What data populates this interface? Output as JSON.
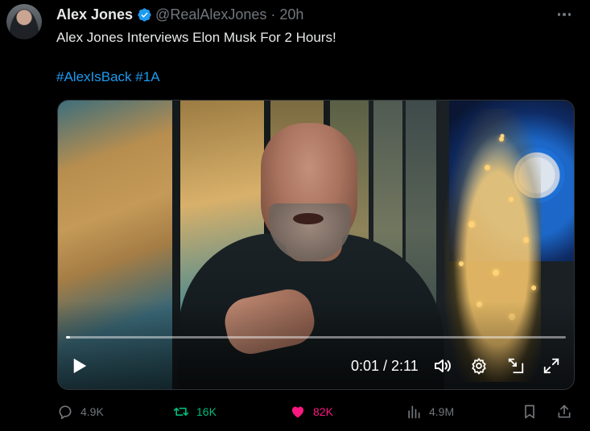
{
  "tweet": {
    "display_name": "Alex Jones",
    "handle": "@RealAlexJones",
    "separator": "·",
    "time": "20h",
    "text": "Alex Jones Interviews Elon Musk For 2 Hours!",
    "hashtags": [
      "#AlexIsBack",
      "#1A"
    ]
  },
  "video": {
    "time_readout": "0:01 / 2:11",
    "progress": 0.008
  },
  "actions": {
    "replies": "4.9K",
    "reposts": "16K",
    "likes": "82K",
    "views": "4.9M"
  },
  "colors": {
    "background": "#000000",
    "text": "#e7e9ea",
    "muted": "#71767b",
    "link": "#1d9bf0",
    "repost": "#00ba7c",
    "like": "#f91880",
    "verified": "#1d9bf0"
  },
  "icons": {
    "verified": "verified-badge-icon",
    "more": "more-dots-icon",
    "play": "play-icon",
    "volume": "volume-icon",
    "settings": "gear-icon",
    "dock": "dock-icon",
    "fullscreen": "fullscreen-icon",
    "reply": "reply-icon",
    "repost": "repost-icon",
    "like": "heart-icon",
    "views": "views-icon",
    "bookmark": "bookmark-icon",
    "share": "share-icon"
  }
}
